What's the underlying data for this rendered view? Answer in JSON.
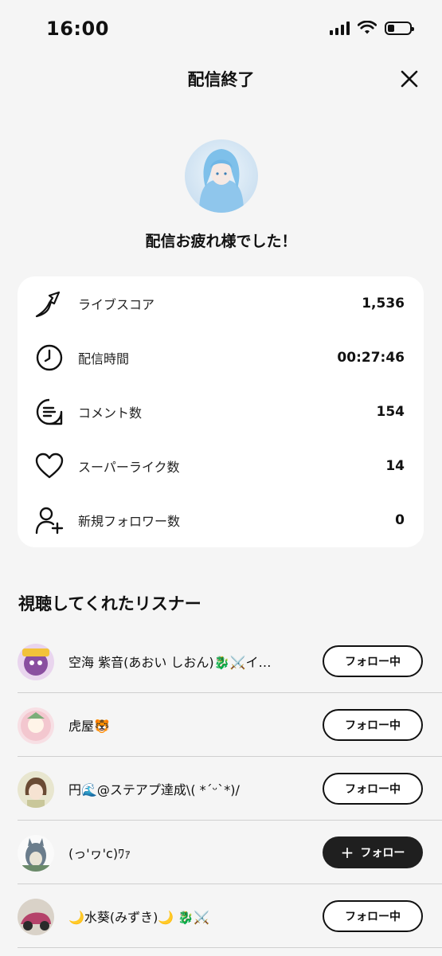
{
  "status_bar": {
    "time": "16:00",
    "battery_fraction": 0.3
  },
  "header": {
    "title": "配信終了"
  },
  "streamer": {
    "message": "配信お疲れ様でした！"
  },
  "stats": [
    {
      "icon": "trending-up-icon",
      "label": "ライブスコア",
      "value": "1,536"
    },
    {
      "icon": "clock-icon",
      "label": "配信時間",
      "value": "00:27:46"
    },
    {
      "icon": "comment-icon",
      "label": "コメント数",
      "value": "154"
    },
    {
      "icon": "heart-icon",
      "label": "スーパーライク数",
      "value": "14"
    },
    {
      "icon": "user-plus-icon",
      "label": "新規フォロワー数",
      "value": "0"
    }
  ],
  "listeners": {
    "title": "視聴してくれたリスナー",
    "items": [
      {
        "name": "空海 紫音(あおい しおん)🐉⚔️イ…",
        "button": "フォロー中",
        "state": "following",
        "avatar_color": "#8a4fa0"
      },
      {
        "name": "虎屋🐯",
        "button": "フォロー中",
        "state": "following",
        "avatar_color": "#f3c7cf"
      },
      {
        "name": "円🌊@ステアプ達成\\( *´ᵕ`*)/",
        "button": "フォロー中",
        "state": "following",
        "avatar_color": "#c9c79a"
      },
      {
        "name": "(っ'ヮ'c)ﾜｧ",
        "button": "フォロー",
        "state": "follow",
        "avatar_color": "#6b8a6a"
      },
      {
        "name": "🌙水葵(みずき)🌙 🐉⚔️",
        "button": "フォロー中",
        "state": "following",
        "avatar_color": "#b5426a"
      }
    ]
  },
  "colors": {
    "background": "#f5f5f5",
    "card": "#ffffff",
    "button_dark": "#1f1f1f"
  }
}
